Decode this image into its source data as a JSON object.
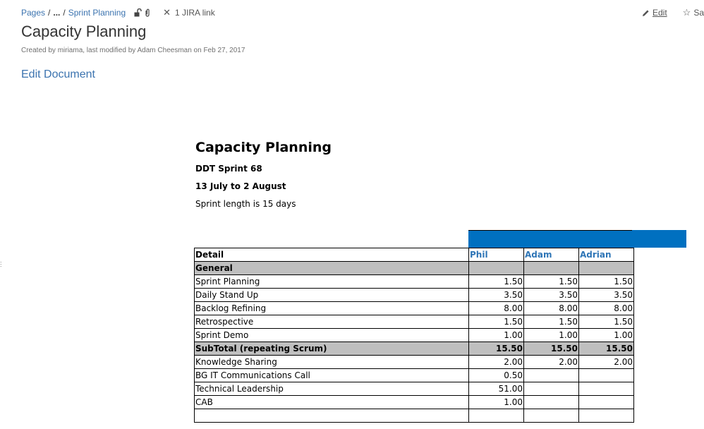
{
  "breadcrumb": {
    "root": "Pages",
    "ellipsis": "...",
    "current": "Sprint Planning",
    "jira_link": "1 JIRA link"
  },
  "actions": {
    "edit": "Edit",
    "save": "Sa"
  },
  "page": {
    "title": "Capacity Planning",
    "byline": "Created by miriama, last modified by Adam Cheesman on Feb 27, 2017",
    "edit_document": "Edit Document"
  },
  "document": {
    "title": "Capacity Planning",
    "sprint": "DDT Sprint 68",
    "dates": "13 July to 2 August",
    "length": "Sprint length is 15 days"
  },
  "table": {
    "header": [
      "Detail",
      "Phil",
      "Adam",
      "Adrian"
    ],
    "rows": [
      {
        "label": "General",
        "cells": [
          "",
          "",
          ""
        ]
      },
      {
        "label": "Sprint Planning",
        "cells": [
          "1.50",
          "1.50",
          "1.50"
        ]
      },
      {
        "label": "Daily Stand Up",
        "cells": [
          "3.50",
          "3.50",
          "3.50"
        ]
      },
      {
        "label": "Backlog Refining",
        "cells": [
          "8.00",
          "8.00",
          "8.00"
        ]
      },
      {
        "label": "Retrospective",
        "cells": [
          "1.50",
          "1.50",
          "1.50"
        ]
      },
      {
        "label": "Sprint Demo",
        "cells": [
          "1.00",
          "1.00",
          "1.00"
        ]
      },
      {
        "label": "SubTotal (repeating Scrum)",
        "cells": [
          "15.50",
          "15.50",
          "15.50"
        ]
      },
      {
        "label": "Knowledge Sharing",
        "cells": [
          "2.00",
          "2.00",
          "2.00"
        ]
      },
      {
        "label": "BG IT Communications Call",
        "cells": [
          "0.50",
          "",
          ""
        ]
      },
      {
        "label": "Technical Leadership",
        "cells": [
          "51.00",
          "",
          ""
        ]
      },
      {
        "label": "CAB",
        "cells": [
          "1.00",
          "",
          ""
        ]
      },
      {
        "label": "",
        "cells": [
          "",
          "",
          ""
        ]
      }
    ]
  },
  "colors": {
    "link": "#3b73af",
    "table_header_blue": "#2e75b6",
    "bar_blue": "#0070c0",
    "grey_row": "#bfbfbf"
  }
}
